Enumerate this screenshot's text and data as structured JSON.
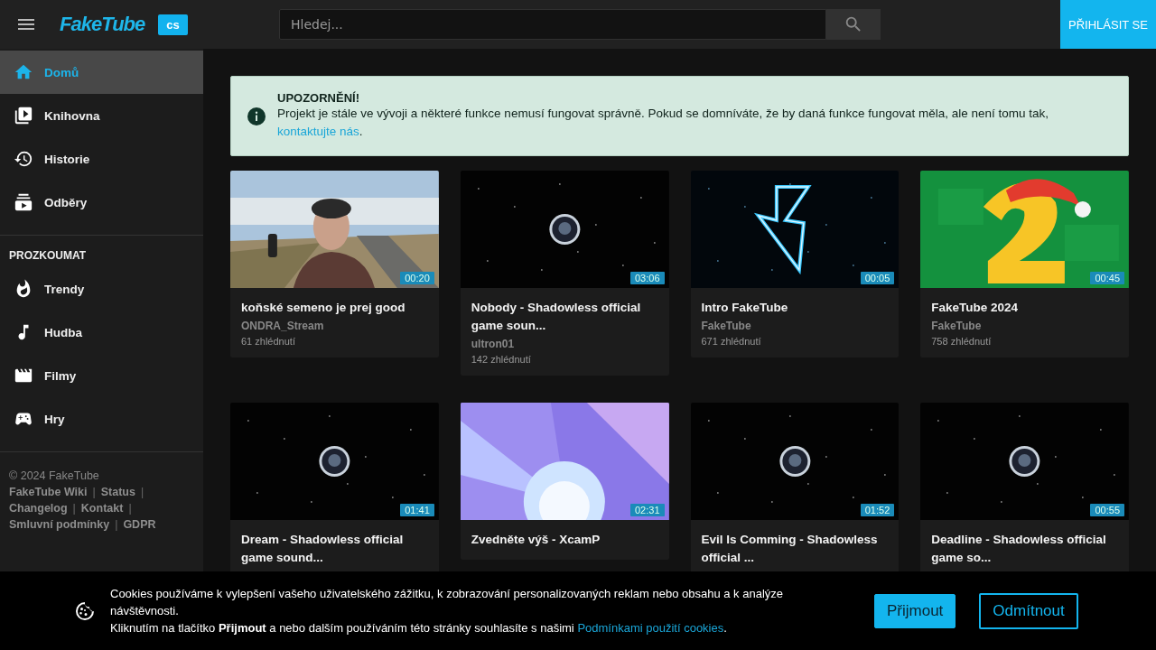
{
  "header": {
    "logo": "FakeTube",
    "language": "cs",
    "search": {
      "placeholder": "Hledej..."
    },
    "login_button": "PŘIHLÁSIT SE"
  },
  "sidebar": {
    "items": [
      {
        "label": "Domů",
        "selected": true
      },
      {
        "label": "Knihovna",
        "selected": false
      },
      {
        "label": "Historie",
        "selected": false
      },
      {
        "label": "Odběry",
        "selected": false
      }
    ],
    "explore": {
      "title": "PROZKOUMAT",
      "items": [
        {
          "label": "Trendy",
          "selected": false
        },
        {
          "label": "Hudba",
          "selected": false
        },
        {
          "label": "Filmy",
          "selected": false
        },
        {
          "label": "Hry",
          "selected": false
        }
      ]
    },
    "footer": {
      "copyright": "© 2024 FakeTube",
      "separator": "|",
      "links": [
        "FakeTube Wiki",
        "Status",
        "Changelog",
        "Kontakt",
        "Smluvní podmínky",
        "GDPR"
      ]
    }
  },
  "notice": {
    "title": "UPOZORNĚNÍ!",
    "text": "Projekt je stále ve vývoji a některé funkce nemusí fungovat správně. Pokud se domníváte, že by daná funkce fungovat měla, ale není tomu tak,",
    "link": "kontaktujte nás",
    "end": "."
  },
  "videos": [
    {
      "duration": "00:20",
      "title": "koňské semeno je prej good",
      "channel": "ONDRA_Stream",
      "views": "61 zhlédnutí"
    },
    {
      "duration": "03:06",
      "title": "Nobody - Shadowless official game soun...",
      "channel": "ultron01",
      "views": "142 zhlédnutí"
    },
    {
      "duration": "00:05",
      "title": "Intro FakeTube",
      "channel": "FakeTube",
      "views": "671 zhlédnutí"
    },
    {
      "duration": "00:45",
      "title": "FakeTube 2024",
      "channel": "FakeTube",
      "views": "758 zhlédnutí"
    },
    {
      "duration": "01:41",
      "title": "Dream - Shadowless official game sound..."
    },
    {
      "duration": "02:31",
      "title": "Zvedněte výš - XcamP"
    },
    {
      "duration": "01:52",
      "title": "Evil Is Comming - Shadowless official ..."
    },
    {
      "duration": "00:55",
      "title": "Deadline - Shadowless official game so..."
    }
  ],
  "cookies": {
    "line1": "Cookies používáme k vylepšení vašeho uživatelského zážitku, k zobrazování personalizovaných reklam nebo obsahu a k analýze návštěvnosti.",
    "line2": "Kliknutím na tlačítko **Přijmout** a nebo dalším používáním této stránky souhlasíte s našimi",
    "link": "Podmínkami použití cookies",
    "end": ".",
    "accept": "Přijmout",
    "decline": "Odmítnout"
  }
}
